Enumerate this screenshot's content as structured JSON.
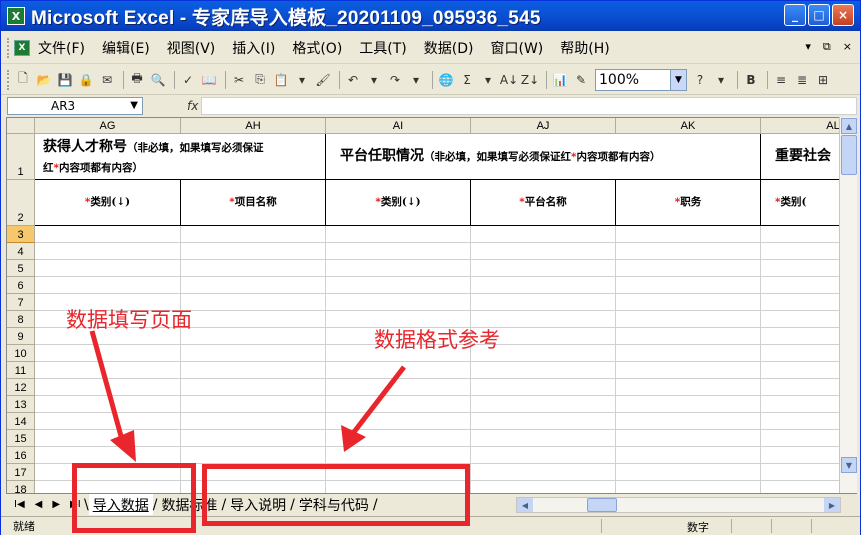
{
  "window": {
    "title": "Microsoft Excel - 专家库导入模板_20201109_095936_545",
    "app_icon_label": "X",
    "controls": [
      "_",
      "□",
      "×"
    ]
  },
  "menubar": {
    "items": [
      "文件(F)",
      "编辑(E)",
      "视图(V)",
      "插入(I)",
      "格式(O)",
      "工具(T)",
      "数据(D)",
      "窗口(W)",
      "帮助(H)"
    ],
    "right_controls": [
      "▾",
      "⧉",
      "×"
    ]
  },
  "toolbar": {
    "zoom": "100%"
  },
  "formula": {
    "name_box": "AR3",
    "fx_label": "fx",
    "content": ""
  },
  "grid": {
    "columns": [
      "AG",
      "AH",
      "AI",
      "AJ",
      "AK",
      "AL"
    ],
    "rows": [
      "1",
      "2",
      "3",
      "4",
      "5",
      "6",
      "7",
      "8",
      "9",
      "10",
      "11",
      "12",
      "13",
      "14",
      "15",
      "16",
      "17",
      "18"
    ],
    "header1": {
      "group1_title": "获得人才称号",
      "group1_note_a": "（非必填，如果填写必须保证",
      "group1_note_b_1": "红",
      "group1_note_b_2": "内容项都有内容）",
      "group2_title": "平台任职情况",
      "group2_note_1": "（非必填，如果填写必须保证红",
      "group2_note_2": "内容项都有内容）",
      "group3_title": "重要社会"
    },
    "header2": {
      "c1": "类别(↓)",
      "c2": "项目名称",
      "c3": "类别(↓)",
      "c4": "平台名称",
      "c5": "职务",
      "c6": "类别("
    },
    "required_mark": "*"
  },
  "sheets": {
    "nav": [
      "I◀",
      "◀",
      "▶",
      "▶I"
    ],
    "tabs": [
      "导入数据",
      "数据标准",
      "导入说明",
      "学科与代码"
    ],
    "active": 0
  },
  "status": {
    "ready": "就绪",
    "num": "数字"
  },
  "annotations": {
    "fill_page": "数据填写页面",
    "format_ref": "数据格式参考"
  }
}
